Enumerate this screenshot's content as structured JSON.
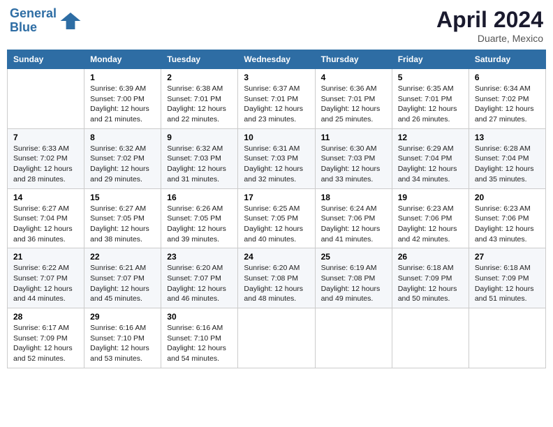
{
  "header": {
    "logo_line1": "General",
    "logo_line2": "Blue",
    "month": "April 2024",
    "location": "Duarte, Mexico"
  },
  "days_of_week": [
    "Sunday",
    "Monday",
    "Tuesday",
    "Wednesday",
    "Thursday",
    "Friday",
    "Saturday"
  ],
  "weeks": [
    [
      {
        "day": "",
        "sunrise": "",
        "sunset": "",
        "daylight": ""
      },
      {
        "day": "1",
        "sunrise": "Sunrise: 6:39 AM",
        "sunset": "Sunset: 7:00 PM",
        "daylight": "Daylight: 12 hours and 21 minutes."
      },
      {
        "day": "2",
        "sunrise": "Sunrise: 6:38 AM",
        "sunset": "Sunset: 7:01 PM",
        "daylight": "Daylight: 12 hours and 22 minutes."
      },
      {
        "day": "3",
        "sunrise": "Sunrise: 6:37 AM",
        "sunset": "Sunset: 7:01 PM",
        "daylight": "Daylight: 12 hours and 23 minutes."
      },
      {
        "day": "4",
        "sunrise": "Sunrise: 6:36 AM",
        "sunset": "Sunset: 7:01 PM",
        "daylight": "Daylight: 12 hours and 25 minutes."
      },
      {
        "day": "5",
        "sunrise": "Sunrise: 6:35 AM",
        "sunset": "Sunset: 7:01 PM",
        "daylight": "Daylight: 12 hours and 26 minutes."
      },
      {
        "day": "6",
        "sunrise": "Sunrise: 6:34 AM",
        "sunset": "Sunset: 7:02 PM",
        "daylight": "Daylight: 12 hours and 27 minutes."
      }
    ],
    [
      {
        "day": "7",
        "sunrise": "Sunrise: 6:33 AM",
        "sunset": "Sunset: 7:02 PM",
        "daylight": "Daylight: 12 hours and 28 minutes."
      },
      {
        "day": "8",
        "sunrise": "Sunrise: 6:32 AM",
        "sunset": "Sunset: 7:02 PM",
        "daylight": "Daylight: 12 hours and 29 minutes."
      },
      {
        "day": "9",
        "sunrise": "Sunrise: 6:32 AM",
        "sunset": "Sunset: 7:03 PM",
        "daylight": "Daylight: 12 hours and 31 minutes."
      },
      {
        "day": "10",
        "sunrise": "Sunrise: 6:31 AM",
        "sunset": "Sunset: 7:03 PM",
        "daylight": "Daylight: 12 hours and 32 minutes."
      },
      {
        "day": "11",
        "sunrise": "Sunrise: 6:30 AM",
        "sunset": "Sunset: 7:03 PM",
        "daylight": "Daylight: 12 hours and 33 minutes."
      },
      {
        "day": "12",
        "sunrise": "Sunrise: 6:29 AM",
        "sunset": "Sunset: 7:04 PM",
        "daylight": "Daylight: 12 hours and 34 minutes."
      },
      {
        "day": "13",
        "sunrise": "Sunrise: 6:28 AM",
        "sunset": "Sunset: 7:04 PM",
        "daylight": "Daylight: 12 hours and 35 minutes."
      }
    ],
    [
      {
        "day": "14",
        "sunrise": "Sunrise: 6:27 AM",
        "sunset": "Sunset: 7:04 PM",
        "daylight": "Daylight: 12 hours and 36 minutes."
      },
      {
        "day": "15",
        "sunrise": "Sunrise: 6:27 AM",
        "sunset": "Sunset: 7:05 PM",
        "daylight": "Daylight: 12 hours and 38 minutes."
      },
      {
        "day": "16",
        "sunrise": "Sunrise: 6:26 AM",
        "sunset": "Sunset: 7:05 PM",
        "daylight": "Daylight: 12 hours and 39 minutes."
      },
      {
        "day": "17",
        "sunrise": "Sunrise: 6:25 AM",
        "sunset": "Sunset: 7:05 PM",
        "daylight": "Daylight: 12 hours and 40 minutes."
      },
      {
        "day": "18",
        "sunrise": "Sunrise: 6:24 AM",
        "sunset": "Sunset: 7:06 PM",
        "daylight": "Daylight: 12 hours and 41 minutes."
      },
      {
        "day": "19",
        "sunrise": "Sunrise: 6:23 AM",
        "sunset": "Sunset: 7:06 PM",
        "daylight": "Daylight: 12 hours and 42 minutes."
      },
      {
        "day": "20",
        "sunrise": "Sunrise: 6:23 AM",
        "sunset": "Sunset: 7:06 PM",
        "daylight": "Daylight: 12 hours and 43 minutes."
      }
    ],
    [
      {
        "day": "21",
        "sunrise": "Sunrise: 6:22 AM",
        "sunset": "Sunset: 7:07 PM",
        "daylight": "Daylight: 12 hours and 44 minutes."
      },
      {
        "day": "22",
        "sunrise": "Sunrise: 6:21 AM",
        "sunset": "Sunset: 7:07 PM",
        "daylight": "Daylight: 12 hours and 45 minutes."
      },
      {
        "day": "23",
        "sunrise": "Sunrise: 6:20 AM",
        "sunset": "Sunset: 7:07 PM",
        "daylight": "Daylight: 12 hours and 46 minutes."
      },
      {
        "day": "24",
        "sunrise": "Sunrise: 6:20 AM",
        "sunset": "Sunset: 7:08 PM",
        "daylight": "Daylight: 12 hours and 48 minutes."
      },
      {
        "day": "25",
        "sunrise": "Sunrise: 6:19 AM",
        "sunset": "Sunset: 7:08 PM",
        "daylight": "Daylight: 12 hours and 49 minutes."
      },
      {
        "day": "26",
        "sunrise": "Sunrise: 6:18 AM",
        "sunset": "Sunset: 7:09 PM",
        "daylight": "Daylight: 12 hours and 50 minutes."
      },
      {
        "day": "27",
        "sunrise": "Sunrise: 6:18 AM",
        "sunset": "Sunset: 7:09 PM",
        "daylight": "Daylight: 12 hours and 51 minutes."
      }
    ],
    [
      {
        "day": "28",
        "sunrise": "Sunrise: 6:17 AM",
        "sunset": "Sunset: 7:09 PM",
        "daylight": "Daylight: 12 hours and 52 minutes."
      },
      {
        "day": "29",
        "sunrise": "Sunrise: 6:16 AM",
        "sunset": "Sunset: 7:10 PM",
        "daylight": "Daylight: 12 hours and 53 minutes."
      },
      {
        "day": "30",
        "sunrise": "Sunrise: 6:16 AM",
        "sunset": "Sunset: 7:10 PM",
        "daylight": "Daylight: 12 hours and 54 minutes."
      },
      {
        "day": "",
        "sunrise": "",
        "sunset": "",
        "daylight": ""
      },
      {
        "day": "",
        "sunrise": "",
        "sunset": "",
        "daylight": ""
      },
      {
        "day": "",
        "sunrise": "",
        "sunset": "",
        "daylight": ""
      },
      {
        "day": "",
        "sunrise": "",
        "sunset": "",
        "daylight": ""
      }
    ]
  ]
}
